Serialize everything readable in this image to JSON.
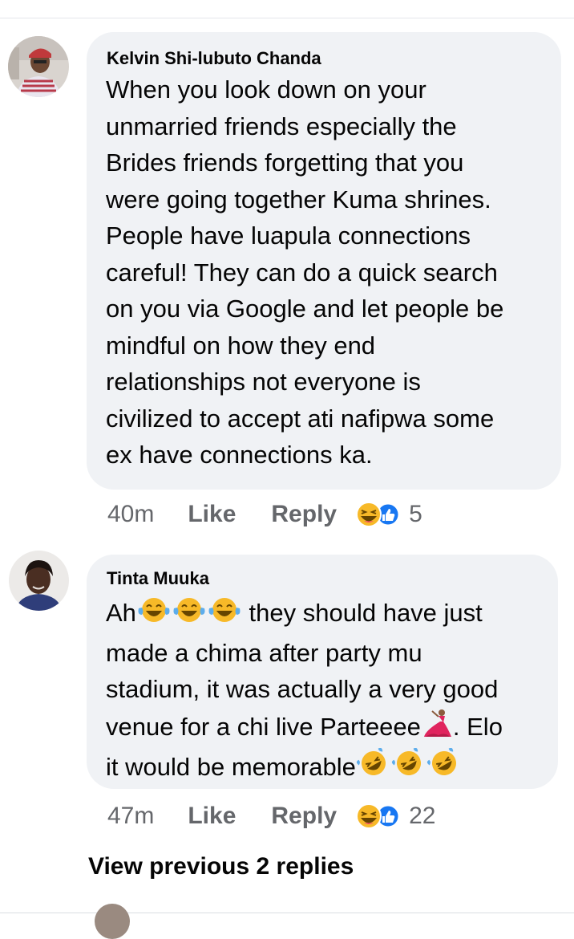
{
  "comments": [
    {
      "author": "Kelvin Shi-lubuto Chanda",
      "text": "When you look down on your\nunmarried friends especially the\nBrides friends forgetting that you\nwere going together Kuma shrines.\nPeople have luapula connections\ncareful! They can do a quick search\non you via Google and let people be\nmindful on how they end\nrelationships not everyone is\ncivilized to accept ati nafipwa some\nex have connections ka.",
      "time": "40m",
      "like_label": "Like",
      "reply_label": "Reply",
      "reaction_icons": [
        "haha-reaction-icon",
        "like-reaction-icon"
      ],
      "reaction_count": "5"
    },
    {
      "author": "Tinta Muuka",
      "text_line1_start": "Ah",
      "text_line1_end": " they should have just",
      "text_lines_mid": "made a chima after party mu\nstadium, it was actually a very good",
      "text_line4_start": "venue for a chi live Parteeee",
      "text_line4_end": ". Elo",
      "text_line5_start": "it would be memorable",
      "time": "47m",
      "like_label": "Like",
      "reply_label": "Reply",
      "reaction_icons": [
        "haha-reaction-icon",
        "like-reaction-icon"
      ],
      "reaction_count": "22"
    }
  ],
  "view_previous_label": "View previous 2 replies",
  "colors": {
    "bubble": "#f0f2f5",
    "meta_text": "#65676b",
    "text": "#050505",
    "like_blue": "#1877f2",
    "haha_yellow": "#f7b928"
  }
}
